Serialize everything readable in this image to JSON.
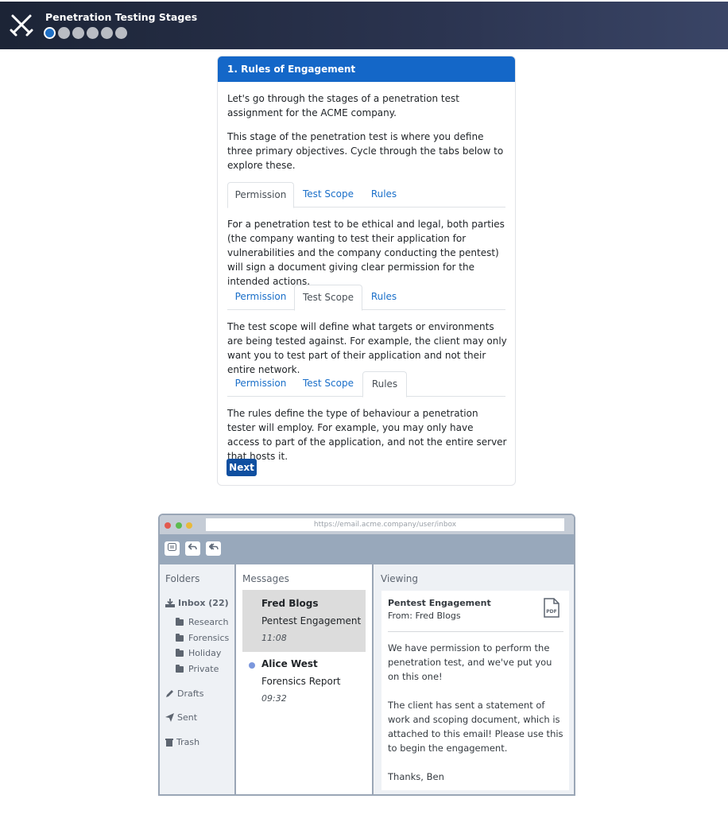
{
  "header": {
    "title": "Penetration Testing Stages",
    "stages_total": 6,
    "current_stage": 1
  },
  "card": {
    "title": "1. Rules of Engagement",
    "intro_1": "Let's go through the stages of a penetration test assignment for the ACME company.",
    "intro_2": "This stage of the penetration test is where you define three primary objectives. Cycle through the tabs below to explore these.",
    "tabs": [
      {
        "label": "Permission"
      },
      {
        "label": "Test Scope"
      },
      {
        "label": "Rules"
      }
    ],
    "panels": [
      {
        "active_tab": "Permission",
        "text": "For a penetration test to be ethical and legal, both parties (the company wanting to test their application for vulnerabilities and the company conducting the pentest) will sign a document giving clear permission for the intended actions."
      },
      {
        "active_tab": "Test Scope",
        "text": "The test scope will define what targets or environments are being tested against. For example, the client may only want you to test part of their application and not their entire network."
      },
      {
        "active_tab": "Rules",
        "text": "The rules define the type of behaviour a penetration tester will employ. For example, you may only have access to part of the application, and not the entire server that hosts it."
      }
    ],
    "next_label": "Next"
  },
  "email": {
    "url": "https://email.acme.company/user/inbox",
    "folders_title": "Folders",
    "inbox_label": "Inbox (22)",
    "subfolders": [
      "Research",
      "Forensics",
      "Holiday",
      "Private"
    ],
    "drafts_label": "Drafts",
    "sent_label": "Sent",
    "trash_label": "Trash",
    "messages_title": "Messages",
    "messages": [
      {
        "sender": "Fred Blogs",
        "subject": "Pentest Engagement",
        "time": "11:08",
        "selected": true,
        "unread": false
      },
      {
        "sender": "Alice West",
        "subject": "Forensics Report",
        "time": "09:32",
        "selected": false,
        "unread": true
      }
    ],
    "viewing_title": "Viewing",
    "open_message": {
      "subject": "Pentest Engagement",
      "from": "From: Fred Blogs",
      "attachment_icon": "pdf-icon",
      "body_1": "We have permission to perform the penetration test, and we've put you on this one!",
      "body_2": "The client has sent a statement of work and scoping document, which is attached to this email! Please use this to begin the engagement.",
      "body_3": "Thanks, Ben"
    }
  },
  "colors": {
    "accent": "#1467c8",
    "next_button": "#0f4fa0",
    "unread_dot": "#7b97dd"
  }
}
